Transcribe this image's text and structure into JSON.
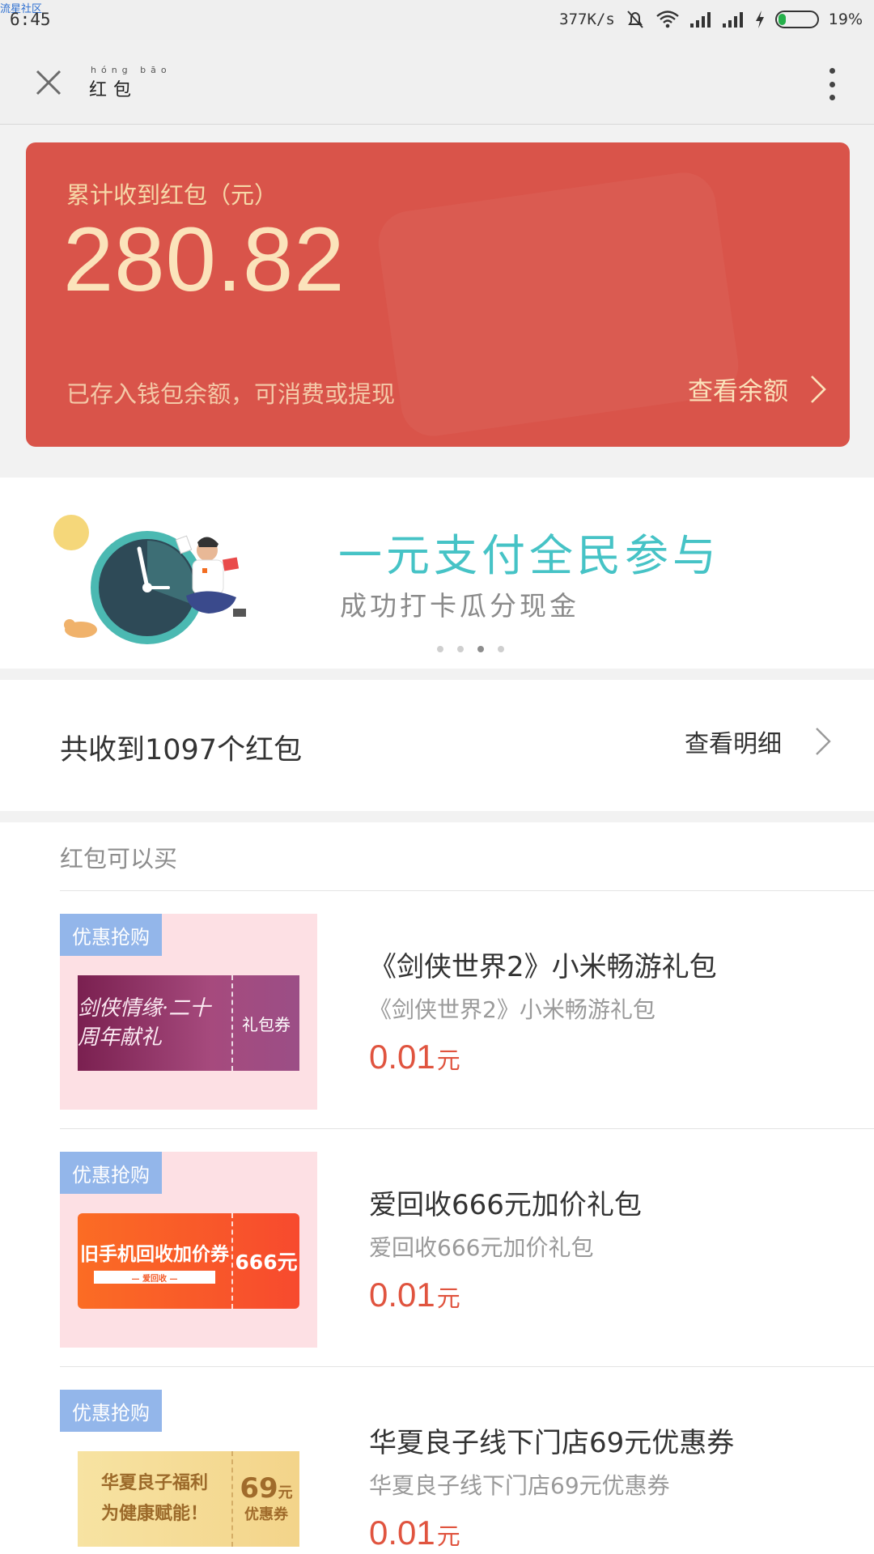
{
  "status_bar": {
    "watermark": "流星社区",
    "time": "6:45",
    "network_speed": "377K/s",
    "battery_percent": "19%",
    "battery_level": 0.19,
    "icons": [
      "mute-bell-icon",
      "wifi-icon",
      "signal-icon",
      "signal-icon",
      "charging-icon",
      "battery-icon"
    ]
  },
  "header": {
    "title_ruby": "hóng bāo",
    "title": "红包",
    "icons": [
      "close-icon",
      "more-vertical-icon"
    ]
  },
  "summary_card": {
    "label": "累计收到红包（元）",
    "amount": "280.82",
    "note": "已存入钱包余额，可消费或提现",
    "balance_link": "查看余额",
    "colors": {
      "background": "#d9544a",
      "amount": "#fbe3bb"
    }
  },
  "banner": {
    "headline": "一元支付全民参与",
    "subline": "成功打卡瓜分现金",
    "slide_count": 4,
    "active_slide": 3,
    "headline_color": "#46c3c6"
  },
  "summary_row": {
    "total_text": "共收到1097个红包",
    "detail_link": "查看明细"
  },
  "offers": {
    "heading": "红包可以买",
    "items": [
      {
        "tag": "优惠抢购",
        "coupon_main": "剑侠情缘·二十周年献礼",
        "coupon_side": "礼包券",
        "name": "《剑侠世界2》小米畅游礼包",
        "desc": "《剑侠世界2》小米畅游礼包",
        "price": "0.01",
        "unit": "元"
      },
      {
        "tag": "优惠抢购",
        "coupon_main": "旧手机回收加价券",
        "coupon_sub": "— 爱回收 —",
        "coupon_side": "666元",
        "name": "爱回收666元加价礼包",
        "desc": "爱回收666元加价礼包",
        "price": "0.01",
        "unit": "元"
      },
      {
        "tag": "优惠抢购",
        "coupon_line1": "华夏良子福利",
        "coupon_line2": "为健康赋能！",
        "coupon_side_value": "69",
        "coupon_side_unit": "元",
        "coupon_side_label": "优惠券",
        "name": "华夏良子线下门店69元优惠券",
        "desc": "华夏良子线下门店69元优惠券",
        "price": "0.01",
        "unit": "元"
      }
    ],
    "tag_color": "#93b6ea",
    "price_color": "#e0543f"
  }
}
